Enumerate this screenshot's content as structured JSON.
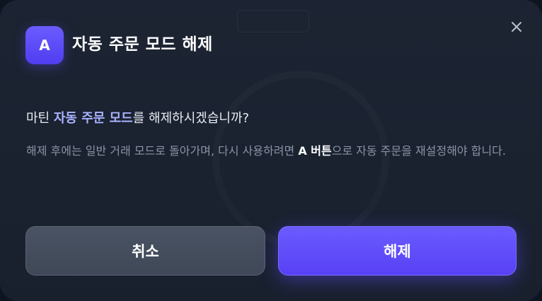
{
  "dialog": {
    "badge_letter": "A",
    "title": "자동 주문 모드 해제",
    "question": {
      "prefix": "마틴 ",
      "highlight": "자동 주문 모드",
      "suffix": "를 해제하시겠습니까?"
    },
    "description": {
      "part1": "해제 후에는 일반 거래 모드로 돌아가며, 다시 사용하려면 ",
      "strong": "A 버튼",
      "part2": "으로 자동 주문을 재설정해야 합니다."
    },
    "buttons": {
      "cancel_label": "취소",
      "confirm_label": "해제"
    },
    "close_icon": "close-icon"
  },
  "colors": {
    "accent": "#5b47f7",
    "dialog_bg": "#1b2231",
    "highlight_text": "#a9b3ff",
    "muted_text": "#8a94a6",
    "cancel_bg": "#444d5c"
  }
}
